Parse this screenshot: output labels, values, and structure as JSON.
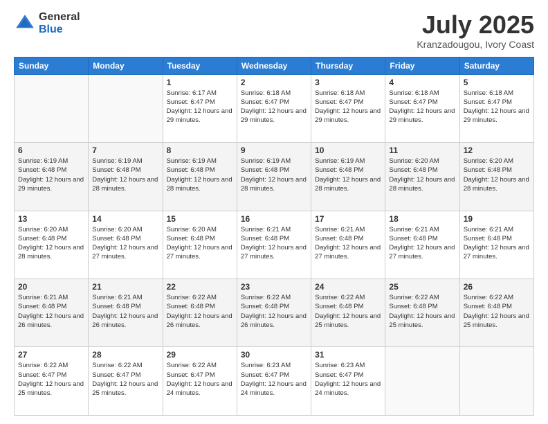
{
  "logo": {
    "general": "General",
    "blue": "Blue"
  },
  "title": "July 2025",
  "location": "Kranzadougou, Ivory Coast",
  "days_of_week": [
    "Sunday",
    "Monday",
    "Tuesday",
    "Wednesday",
    "Thursday",
    "Friday",
    "Saturday"
  ],
  "weeks": [
    [
      {
        "day": "",
        "sunrise": "",
        "sunset": "",
        "daylight": ""
      },
      {
        "day": "",
        "sunrise": "",
        "sunset": "",
        "daylight": ""
      },
      {
        "day": "1",
        "sunrise": "Sunrise: 6:17 AM",
        "sunset": "Sunset: 6:47 PM",
        "daylight": "Daylight: 12 hours and 29 minutes."
      },
      {
        "day": "2",
        "sunrise": "Sunrise: 6:18 AM",
        "sunset": "Sunset: 6:47 PM",
        "daylight": "Daylight: 12 hours and 29 minutes."
      },
      {
        "day": "3",
        "sunrise": "Sunrise: 6:18 AM",
        "sunset": "Sunset: 6:47 PM",
        "daylight": "Daylight: 12 hours and 29 minutes."
      },
      {
        "day": "4",
        "sunrise": "Sunrise: 6:18 AM",
        "sunset": "Sunset: 6:47 PM",
        "daylight": "Daylight: 12 hours and 29 minutes."
      },
      {
        "day": "5",
        "sunrise": "Sunrise: 6:18 AM",
        "sunset": "Sunset: 6:47 PM",
        "daylight": "Daylight: 12 hours and 29 minutes."
      }
    ],
    [
      {
        "day": "6",
        "sunrise": "Sunrise: 6:19 AM",
        "sunset": "Sunset: 6:48 PM",
        "daylight": "Daylight: 12 hours and 29 minutes."
      },
      {
        "day": "7",
        "sunrise": "Sunrise: 6:19 AM",
        "sunset": "Sunset: 6:48 PM",
        "daylight": "Daylight: 12 hours and 28 minutes."
      },
      {
        "day": "8",
        "sunrise": "Sunrise: 6:19 AM",
        "sunset": "Sunset: 6:48 PM",
        "daylight": "Daylight: 12 hours and 28 minutes."
      },
      {
        "day": "9",
        "sunrise": "Sunrise: 6:19 AM",
        "sunset": "Sunset: 6:48 PM",
        "daylight": "Daylight: 12 hours and 28 minutes."
      },
      {
        "day": "10",
        "sunrise": "Sunrise: 6:19 AM",
        "sunset": "Sunset: 6:48 PM",
        "daylight": "Daylight: 12 hours and 28 minutes."
      },
      {
        "day": "11",
        "sunrise": "Sunrise: 6:20 AM",
        "sunset": "Sunset: 6:48 PM",
        "daylight": "Daylight: 12 hours and 28 minutes."
      },
      {
        "day": "12",
        "sunrise": "Sunrise: 6:20 AM",
        "sunset": "Sunset: 6:48 PM",
        "daylight": "Daylight: 12 hours and 28 minutes."
      }
    ],
    [
      {
        "day": "13",
        "sunrise": "Sunrise: 6:20 AM",
        "sunset": "Sunset: 6:48 PM",
        "daylight": "Daylight: 12 hours and 28 minutes."
      },
      {
        "day": "14",
        "sunrise": "Sunrise: 6:20 AM",
        "sunset": "Sunset: 6:48 PM",
        "daylight": "Daylight: 12 hours and 27 minutes."
      },
      {
        "day": "15",
        "sunrise": "Sunrise: 6:20 AM",
        "sunset": "Sunset: 6:48 PM",
        "daylight": "Daylight: 12 hours and 27 minutes."
      },
      {
        "day": "16",
        "sunrise": "Sunrise: 6:21 AM",
        "sunset": "Sunset: 6:48 PM",
        "daylight": "Daylight: 12 hours and 27 minutes."
      },
      {
        "day": "17",
        "sunrise": "Sunrise: 6:21 AM",
        "sunset": "Sunset: 6:48 PM",
        "daylight": "Daylight: 12 hours and 27 minutes."
      },
      {
        "day": "18",
        "sunrise": "Sunrise: 6:21 AM",
        "sunset": "Sunset: 6:48 PM",
        "daylight": "Daylight: 12 hours and 27 minutes."
      },
      {
        "day": "19",
        "sunrise": "Sunrise: 6:21 AM",
        "sunset": "Sunset: 6:48 PM",
        "daylight": "Daylight: 12 hours and 27 minutes."
      }
    ],
    [
      {
        "day": "20",
        "sunrise": "Sunrise: 6:21 AM",
        "sunset": "Sunset: 6:48 PM",
        "daylight": "Daylight: 12 hours and 26 minutes."
      },
      {
        "day": "21",
        "sunrise": "Sunrise: 6:21 AM",
        "sunset": "Sunset: 6:48 PM",
        "daylight": "Daylight: 12 hours and 26 minutes."
      },
      {
        "day": "22",
        "sunrise": "Sunrise: 6:22 AM",
        "sunset": "Sunset: 6:48 PM",
        "daylight": "Daylight: 12 hours and 26 minutes."
      },
      {
        "day": "23",
        "sunrise": "Sunrise: 6:22 AM",
        "sunset": "Sunset: 6:48 PM",
        "daylight": "Daylight: 12 hours and 26 minutes."
      },
      {
        "day": "24",
        "sunrise": "Sunrise: 6:22 AM",
        "sunset": "Sunset: 6:48 PM",
        "daylight": "Daylight: 12 hours and 25 minutes."
      },
      {
        "day": "25",
        "sunrise": "Sunrise: 6:22 AM",
        "sunset": "Sunset: 6:48 PM",
        "daylight": "Daylight: 12 hours and 25 minutes."
      },
      {
        "day": "26",
        "sunrise": "Sunrise: 6:22 AM",
        "sunset": "Sunset: 6:48 PM",
        "daylight": "Daylight: 12 hours and 25 minutes."
      }
    ],
    [
      {
        "day": "27",
        "sunrise": "Sunrise: 6:22 AM",
        "sunset": "Sunset: 6:47 PM",
        "daylight": "Daylight: 12 hours and 25 minutes."
      },
      {
        "day": "28",
        "sunrise": "Sunrise: 6:22 AM",
        "sunset": "Sunset: 6:47 PM",
        "daylight": "Daylight: 12 hours and 25 minutes."
      },
      {
        "day": "29",
        "sunrise": "Sunrise: 6:22 AM",
        "sunset": "Sunset: 6:47 PM",
        "daylight": "Daylight: 12 hours and 24 minutes."
      },
      {
        "day": "30",
        "sunrise": "Sunrise: 6:23 AM",
        "sunset": "Sunset: 6:47 PM",
        "daylight": "Daylight: 12 hours and 24 minutes."
      },
      {
        "day": "31",
        "sunrise": "Sunrise: 6:23 AM",
        "sunset": "Sunset: 6:47 PM",
        "daylight": "Daylight: 12 hours and 24 minutes."
      },
      {
        "day": "",
        "sunrise": "",
        "sunset": "",
        "daylight": ""
      },
      {
        "day": "",
        "sunrise": "",
        "sunset": "",
        "daylight": ""
      }
    ]
  ]
}
